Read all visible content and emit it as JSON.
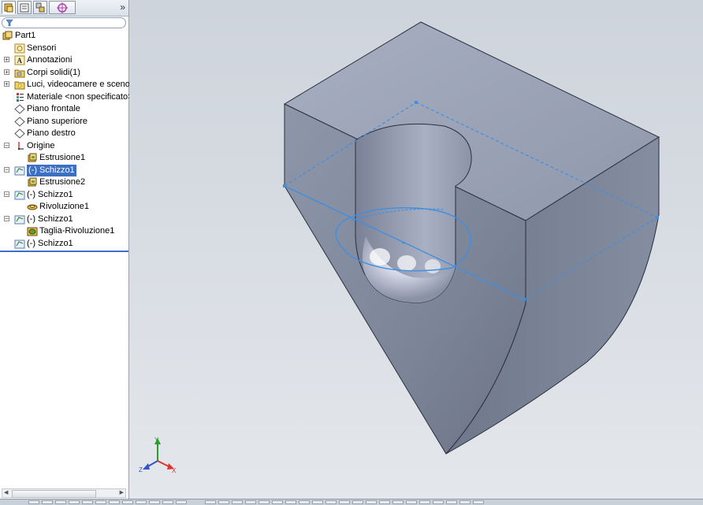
{
  "tree": {
    "root": "Part1",
    "items": [
      {
        "label": "Sensori",
        "icon": "sensor-icon"
      },
      {
        "label": "Annotazioni",
        "icon": "annotation-icon"
      },
      {
        "label": "Corpi solidi(1)",
        "icon": "solid-bodies-folder-icon"
      },
      {
        "label": "Luci, videocamere e scenog",
        "icon": "lights-cameras-icon"
      },
      {
        "label": "Materiale <non specificato>",
        "icon": "material-icon"
      },
      {
        "label": "Piano frontale",
        "icon": "plane-icon"
      },
      {
        "label": "Piano superiore",
        "icon": "plane-icon"
      },
      {
        "label": "Piano destro",
        "icon": "plane-icon"
      },
      {
        "label": "Origine",
        "icon": "origin-icon"
      },
      {
        "label": "Estrusione1",
        "icon": "extrude-icon"
      },
      {
        "label": "(-) Schizzo1",
        "icon": "sketch-icon",
        "selected": true
      },
      {
        "label": "Estrusione2",
        "icon": "extrude-icon"
      },
      {
        "label": "(-) Schizzo1",
        "icon": "sketch-icon"
      },
      {
        "label": "Rivoluzione1",
        "icon": "revolve-icon"
      },
      {
        "label": "(-) Schizzo1",
        "icon": "sketch-icon"
      },
      {
        "label": "Taglia-Rivoluzione1",
        "icon": "cut-revolve-icon"
      },
      {
        "label": "(-) Schizzo1",
        "icon": "sketch-icon"
      }
    ]
  },
  "triad": {
    "x": "X",
    "y": "Y",
    "z": "Z"
  },
  "colors": {
    "selection": "#3d6fc5",
    "sketch_line": "#3f8fe0",
    "viewport_bg": "#d4d9e0"
  }
}
